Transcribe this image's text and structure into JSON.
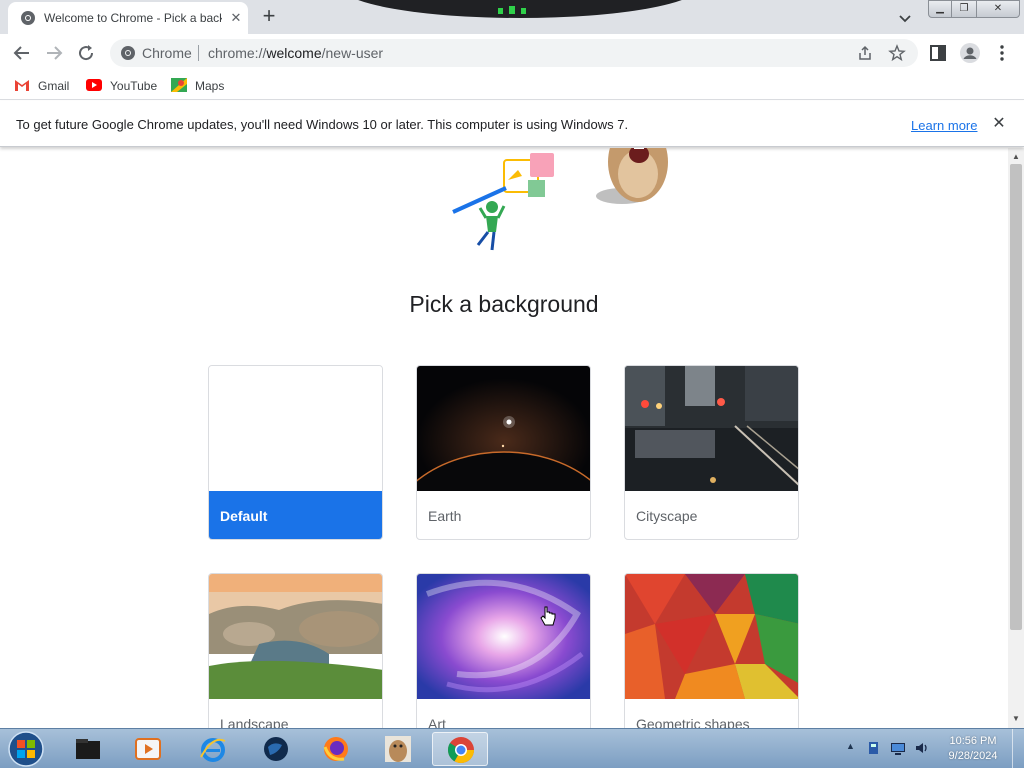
{
  "browser": {
    "tab_title": "Welcome to Chrome - Pick a background",
    "tab_close": "✕",
    "new_tab": "+",
    "window_controls": {
      "minimize": "▁",
      "maximize": "❐",
      "close": "✕"
    }
  },
  "toolbar": {
    "site_label": "Chrome",
    "url_scheme": "chrome://",
    "url_host": "welcome",
    "url_path": "/new-user"
  },
  "bookmarks": [
    {
      "label": "Gmail",
      "icon": "gmail-icon"
    },
    {
      "label": "YouTube",
      "icon": "youtube-icon"
    },
    {
      "label": "Maps",
      "icon": "maps-icon"
    }
  ],
  "infobar": {
    "message": "To get future Google Chrome updates, you'll need Windows 10 or later. This computer is using Windows 7.",
    "link": "Learn more",
    "close": "✕"
  },
  "page": {
    "heading": "Pick a background",
    "backgrounds": [
      {
        "label": "Default",
        "selected": true
      },
      {
        "label": "Earth",
        "selected": false
      },
      {
        "label": "Cityscape",
        "selected": false
      },
      {
        "label": "Landscape",
        "selected": false
      },
      {
        "label": "Art",
        "selected": false
      },
      {
        "label": "Geometric shapes",
        "selected": false
      }
    ]
  },
  "taskbar": {
    "apps": [
      "explorer",
      "media-player",
      "internet-explorer",
      "earth-browser",
      "firefox",
      "gopher-app",
      "chrome"
    ],
    "active_app": "chrome",
    "clock_time": "10:56 PM",
    "clock_date": "9/28/2024"
  },
  "colors": {
    "accent": "#1a73e8",
    "taskbar": "#8fb0d1"
  }
}
